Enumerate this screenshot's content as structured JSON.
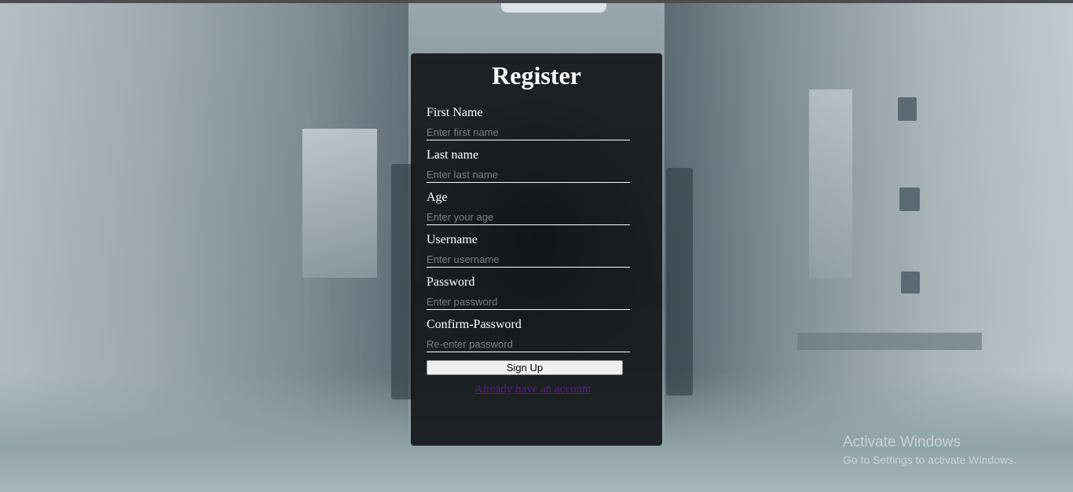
{
  "form": {
    "title": "Register",
    "fields": [
      {
        "label": "First Name",
        "placeholder": "Enter first name",
        "value": ""
      },
      {
        "label": "Last name",
        "placeholder": "Enter last name",
        "value": ""
      },
      {
        "label": "Age",
        "placeholder": "Enter your age",
        "value": ""
      },
      {
        "label": "Username",
        "placeholder": "Enter username",
        "value": ""
      },
      {
        "label": "Password",
        "placeholder": "Enter password",
        "value": ""
      },
      {
        "label": "Confirm-Password",
        "placeholder": "Re-enter password",
        "value": ""
      }
    ],
    "submit_label": "Sign Up",
    "login_link": "Already have an account"
  },
  "watermark": {
    "title": "Activate Windows",
    "subtitle": "Go to Settings to activate Windows."
  },
  "colors": {
    "card_bg": "#121416",
    "link": "#551a8b",
    "text": "#ffffff"
  }
}
